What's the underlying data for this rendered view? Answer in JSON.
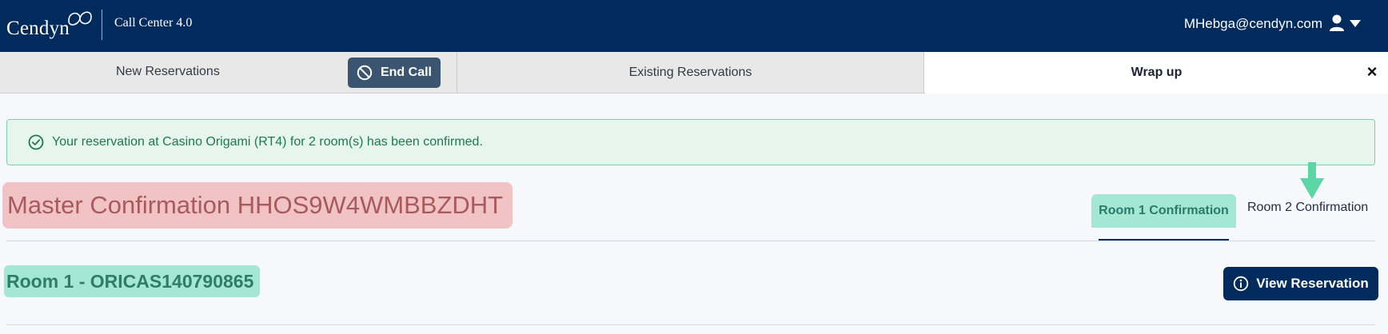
{
  "header": {
    "logo_text": "Cendyn",
    "app_title": "Call Center 4.0",
    "user_email": "MHebga@cendyn.com",
    "brand_color": "#002b5c"
  },
  "tabs": {
    "new_reservations": "New Reservations",
    "end_call": "End Call",
    "existing_reservations": "Existing Reservations",
    "wrap_up": "Wrap up",
    "close": "×"
  },
  "alert": {
    "message": "Your reservation at Casino Origami (RT4) for 2 room(s) has been confirmed.",
    "icon": "check-circle-icon",
    "color": "#1d7a4b"
  },
  "confirmation": {
    "master_label": "Master Confirmation HHOS9W4WMBBZDHT",
    "room_tabs": [
      {
        "label": "Room 1 Confirmation",
        "active": true
      },
      {
        "label": "Room 2 Confirmation",
        "active": false
      }
    ],
    "room_heading": "Room 1 - ORICAS140790865",
    "view_reservation": "View Reservation"
  },
  "icons": {
    "end_call": "ban-icon",
    "user": "user-icon",
    "dropdown": "caret-down-icon",
    "view": "info-circle-icon",
    "pointer": "arrow-down-icon"
  }
}
